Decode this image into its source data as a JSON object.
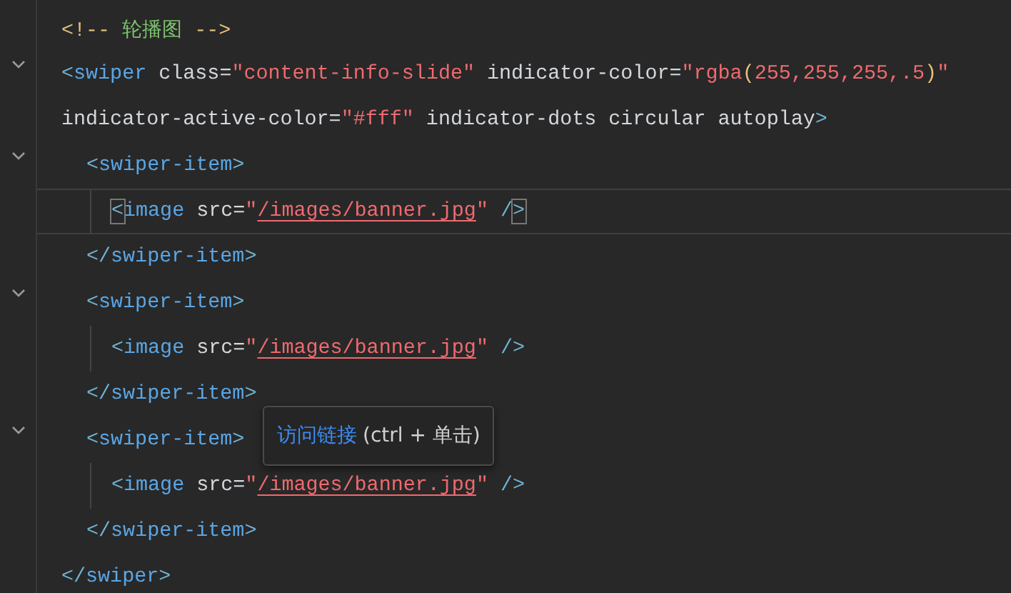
{
  "lines": [
    {
      "current": false,
      "tokens": [
        {
          "kind": "comment",
          "text": "<!--"
        },
        {
          "kind": "comment_text",
          "text": " 轮播图 "
        },
        {
          "kind": "comment",
          "text": "-->"
        }
      ]
    },
    {
      "current": false,
      "expanded": true,
      "tokens": [
        {
          "kind": "punct",
          "text": "<"
        },
        {
          "kind": "tag",
          "text": "swiper"
        },
        {
          "kind": "attr",
          "text": " class="
        },
        {
          "kind": "string",
          "text": "\"content-info-slide\""
        },
        {
          "kind": "attr",
          "text": " indicator-color="
        },
        {
          "kind": "string",
          "text": "\"rgba"
        },
        {
          "kind": "paren",
          "text": "("
        },
        {
          "kind": "string",
          "text": "255,255,255,.5"
        },
        {
          "kind": "paren",
          "text": ")"
        },
        {
          "kind": "string",
          "text": "\""
        }
      ],
      "continuation": [
        {
          "kind": "attr",
          "text": "indicator-active-color="
        },
        {
          "kind": "string",
          "text": "\"#fff\""
        },
        {
          "kind": "attr",
          "text": " indicator-dots circular autoplay"
        },
        {
          "kind": "punct",
          "text": ">"
        }
      ],
      "children": [
        {
          "current": false,
          "expanded": true,
          "tokens": [
            {
              "kind": "punct",
              "text": "<"
            },
            {
              "kind": "tag",
              "text": "swiper-item"
            },
            {
              "kind": "punct",
              "text": ">"
            }
          ],
          "children": [
            {
              "current": true,
              "tokens": [
                {
                  "kind": "punct",
                  "text": "<"
                },
                {
                  "kind": "tag",
                  "text": "image"
                },
                {
                  "kind": "attr",
                  "text": " src="
                },
                {
                  "kind": "string",
                  "text": "\""
                },
                {
                  "kind": "link",
                  "text": "/images/banner.jpg"
                },
                {
                  "kind": "string",
                  "text": "\""
                },
                {
                  "kind": "punct",
                  "text": " /"
                },
                {
                  "kind": "punct",
                  "text": ">"
                }
              ]
            }
          ]
        },
        {
          "current": false,
          "tokens": [
            {
              "kind": "punct",
              "text": "</"
            },
            {
              "kind": "tag",
              "text": "swiper-item"
            },
            {
              "kind": "punct",
              "text": ">"
            }
          ]
        },
        {
          "current": false,
          "expanded": true,
          "tokens": [
            {
              "kind": "punct",
              "text": "<"
            },
            {
              "kind": "tag",
              "text": "swiper-item"
            },
            {
              "kind": "punct",
              "text": ">"
            }
          ],
          "children": [
            {
              "current": false,
              "tokens": [
                {
                  "kind": "punct",
                  "text": "<"
                },
                {
                  "kind": "tag",
                  "text": "image"
                },
                {
                  "kind": "attr",
                  "text": " src="
                },
                {
                  "kind": "string",
                  "text": "\""
                },
                {
                  "kind": "link",
                  "text": "/images/banner.jpg"
                },
                {
                  "kind": "string",
                  "text": "\""
                },
                {
                  "kind": "punct",
                  "text": " /"
                },
                {
                  "kind": "punct",
                  "text": ">"
                }
              ]
            }
          ]
        },
        {
          "current": false,
          "tokens": [
            {
              "kind": "punct",
              "text": "</"
            },
            {
              "kind": "tag",
              "text": "swiper-item"
            },
            {
              "kind": "punct",
              "text": ">"
            }
          ]
        },
        {
          "current": false,
          "expanded": true,
          "tokens": [
            {
              "kind": "punct",
              "text": "<"
            },
            {
              "kind": "tag",
              "text": "swiper-item"
            },
            {
              "kind": "punct",
              "text": ">"
            }
          ],
          "children": [
            {
              "current": false,
              "tokens": [
                {
                  "kind": "punct",
                  "text": "<"
                },
                {
                  "kind": "tag",
                  "text": "image"
                },
                {
                  "kind": "attr",
                  "text": " src="
                },
                {
                  "kind": "string",
                  "text": "\""
                },
                {
                  "kind": "link",
                  "text": "/images/banner.jpg"
                },
                {
                  "kind": "string",
                  "text": "\""
                },
                {
                  "kind": "punct",
                  "text": " /"
                },
                {
                  "kind": "punct",
                  "text": ">"
                }
              ]
            }
          ]
        },
        {
          "current": false,
          "tokens": [
            {
              "kind": "punct",
              "text": "</"
            },
            {
              "kind": "tag",
              "text": "swiper-item"
            },
            {
              "kind": "punct",
              "text": ">"
            }
          ]
        }
      ]
    },
    {
      "current": false,
      "tokens": [
        {
          "kind": "punct",
          "text": "</"
        },
        {
          "kind": "tag",
          "text": "swiper"
        },
        {
          "kind": "punct",
          "text": ">"
        }
      ]
    }
  ],
  "tooltip": {
    "link": "访问链接",
    "hint": "(ctrl + 单击)"
  }
}
